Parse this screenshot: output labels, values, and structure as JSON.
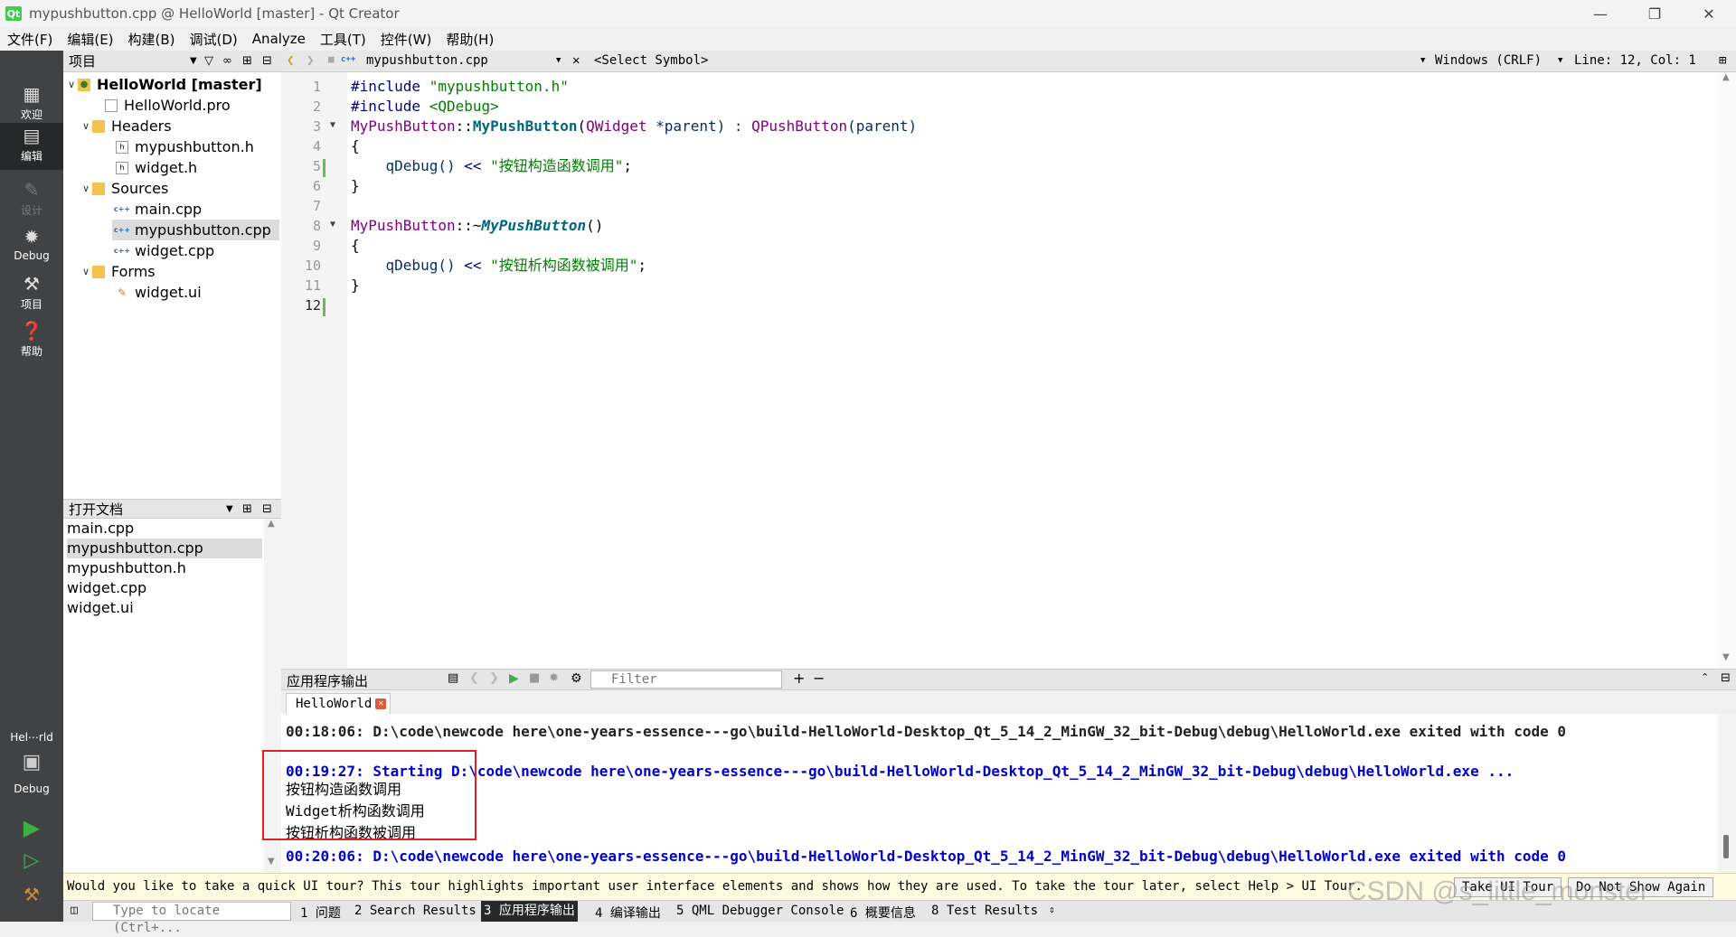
{
  "window": {
    "title": "mypushbutton.cpp @ HelloWorld [master] - Qt Creator"
  },
  "menu": [
    "文件(F)",
    "编辑(E)",
    "构建(B)",
    "调试(D)",
    "Analyze",
    "工具(T)",
    "控件(W)",
    "帮助(H)"
  ],
  "modes": [
    {
      "label": "欢迎",
      "icon": "grid-icon"
    },
    {
      "label": "编辑",
      "icon": "edit-icon"
    },
    {
      "label": "设计",
      "icon": "pen-icon"
    },
    {
      "label": "Debug",
      "icon": "bug-icon"
    },
    {
      "label": "项目",
      "icon": "wrench-icon"
    },
    {
      "label": "帮助",
      "icon": "help-icon"
    }
  ],
  "kit": {
    "project": "Hel⋯rld",
    "config": "Debug"
  },
  "project_panel": {
    "title": "项目",
    "tree": [
      {
        "label": "HelloWorld [master]",
        "kind": "project"
      },
      {
        "label": "HelloWorld.pro",
        "kind": "pro"
      },
      {
        "label": "Headers",
        "kind": "folder"
      },
      {
        "label": "mypushbutton.h",
        "kind": "h"
      },
      {
        "label": "widget.h",
        "kind": "h"
      },
      {
        "label": "Sources",
        "kind": "folder"
      },
      {
        "label": "main.cpp",
        "kind": "cpp"
      },
      {
        "label": "mypushbutton.cpp",
        "kind": "cpp"
      },
      {
        "label": "widget.cpp",
        "kind": "cpp"
      },
      {
        "label": "Forms",
        "kind": "folder"
      },
      {
        "label": "widget.ui",
        "kind": "ui"
      }
    ]
  },
  "open_docs": {
    "title": "打开文档",
    "items": [
      "main.cpp",
      "mypushbutton.cpp",
      "mypushbutton.h",
      "widget.cpp",
      "widget.ui"
    ]
  },
  "editor_toolbar": {
    "file": "mypushbutton.cpp",
    "symbol": "<Select Symbol>",
    "line_ending": "Windows (CRLF)",
    "position": "Line: 12, Col: 1"
  },
  "editor": {
    "line_numbers": [
      "1",
      "2",
      "3",
      "4",
      "5",
      "6",
      "7",
      "8",
      "9",
      "10",
      "11",
      "12"
    ],
    "code": {
      "l1_pp": "#include ",
      "l1_str": "\"mypushbutton.h\"",
      "l2_pp": "#include ",
      "l2_str": "<QDebug>",
      "l3_class": "MyPushButton",
      "l3_sep": "::",
      "l3_fn": "MyPushButton",
      "l3_p1": "(",
      "l3_type": "QWidget",
      "l3_arg": " *parent) : ",
      "l3_base": "QPushButton",
      "l3_end": "(parent)",
      "l4": "{",
      "l5_fn": "    qDebug() ",
      "l5_op": "<< ",
      "l5_str": "\"按钮构造函数调用\"",
      "l5_end": ";",
      "l6": "}",
      "l8_class": "MyPushButton",
      "l8_sep": "::~",
      "l8_fn": "MyPushButton",
      "l8_end": "()",
      "l9": "{",
      "l10_fn": "    qDebug() ",
      "l10_op": "<< ",
      "l10_str": "\"按钮析构函数被调用\"",
      "l10_end": ";",
      "l11": "}"
    }
  },
  "output_pane": {
    "title": "应用程序输出",
    "filter_placeholder": "Filter",
    "tab": "HelloWorld",
    "lines": [
      "00:18:06: D:\\code\\newcode here\\one-years-essence---go\\build-HelloWorld-Desktop_Qt_5_14_2_MinGW_32_bit-Debug\\debug\\HelloWorld.exe exited with code 0",
      "",
      "00:19:27: Starting D:\\code\\newcode here\\one-years-essence---go\\build-HelloWorld-Desktop_Qt_5_14_2_MinGW_32_bit-Debug\\debug\\HelloWorld.exe ...",
      "按钮构造函数调用",
      "Widget析构函数调用",
      "按钮析构函数被调用",
      "00:20:06: D:\\code\\newcode here\\one-years-essence---go\\build-HelloWorld-Desktop_Qt_5_14_2_MinGW_32_bit-Debug\\debug\\HelloWorld.exe exited with code 0"
    ]
  },
  "tour_bar": {
    "message": "Would you like to take a quick UI tour? This tour highlights important user interface elements and shows how they are used. To take the tour later, select Help > UI Tour.",
    "take_label": "Take UI Tour",
    "dismiss_label": "Do Not Show Again"
  },
  "status_bar": {
    "locator_placeholder": "Type to locate (Ctrl+...",
    "tabs": [
      "1 问题",
      "2 Search Results",
      "3 应用程序输出",
      "4 编译输出",
      "5 QML Debugger Console",
      "6 概要信息",
      "8 Test Results"
    ]
  },
  "watermark": "CSDN @s_little_monster"
}
